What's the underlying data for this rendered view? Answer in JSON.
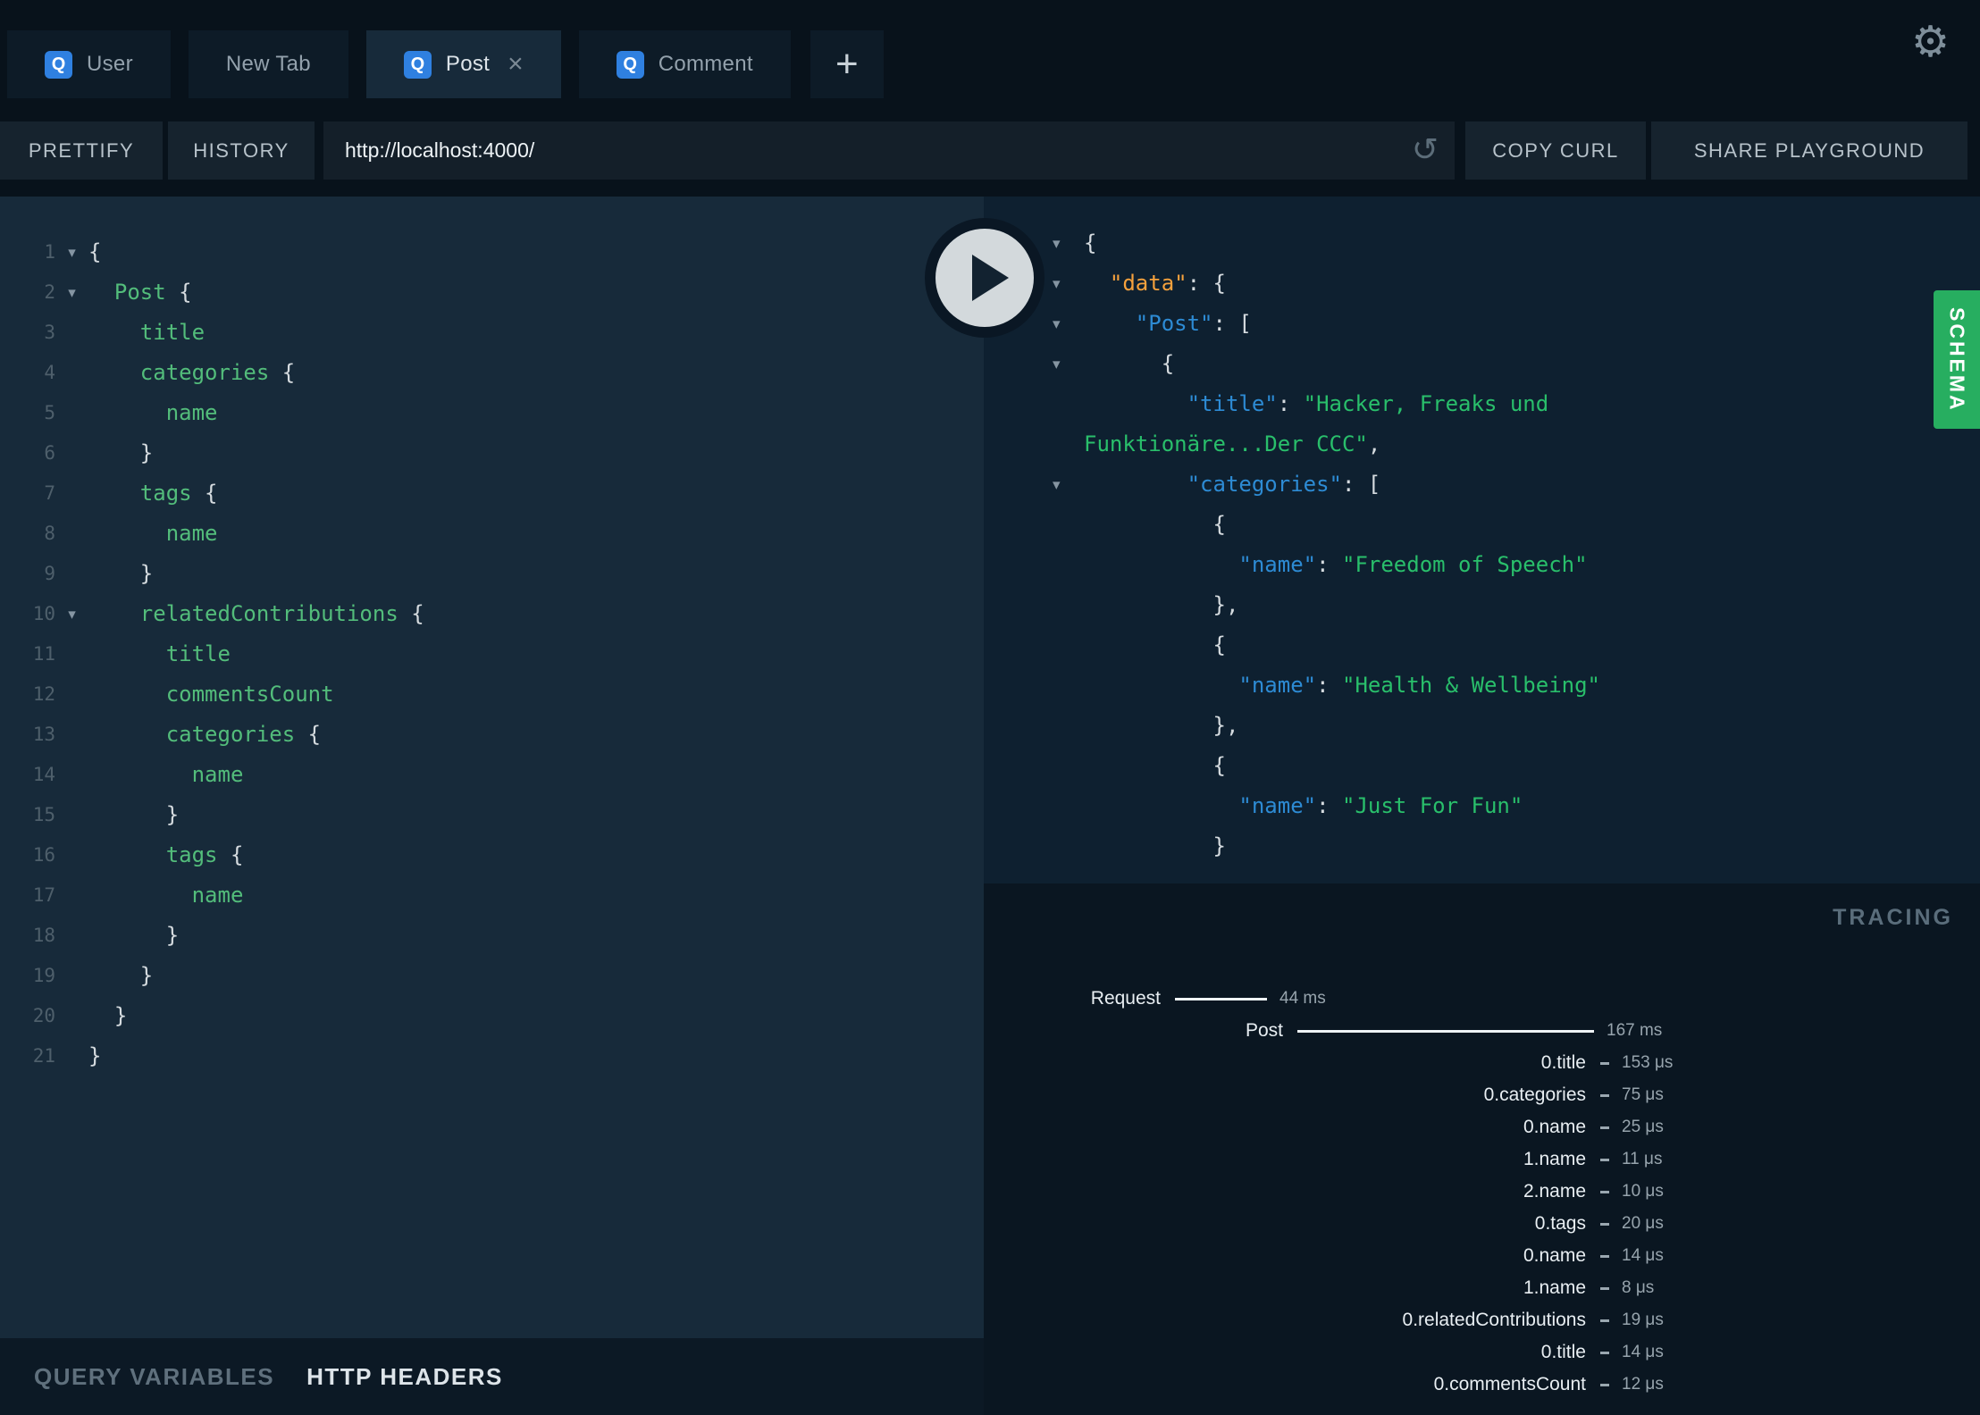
{
  "icons": {
    "settings": "⚙",
    "reload": "↺",
    "fold": "▾",
    "close": "×",
    "plus": "+"
  },
  "colors": {
    "accent_blue": "#2f80e0",
    "schema_green": "#27ae60",
    "field_green": "#53bd7b",
    "key_blue": "#2d8bd4",
    "root_key_orange": "#f5a13d",
    "string_green": "#29bf6b"
  },
  "tabs": {
    "items": [
      {
        "badge": "Q",
        "label": "User",
        "active": false,
        "closable": false
      },
      {
        "badge": null,
        "label": "New Tab",
        "active": false,
        "closable": false
      },
      {
        "badge": "Q",
        "label": "Post",
        "active": true,
        "closable": true
      },
      {
        "badge": "Q",
        "label": "Comment",
        "active": false,
        "closable": false
      }
    ],
    "new_tab_label": "+"
  },
  "toolbar": {
    "prettify_label": "PRETTIFY",
    "history_label": "HISTORY",
    "url_value": "http://localhost:4000/",
    "copy_curl_label": "COPY CURL",
    "share_label": "SHARE PLAYGROUND"
  },
  "schema_tab_label": "SCHEMA",
  "bottom_tabs": {
    "query_variables": "QUERY VARIABLES",
    "http_headers": "HTTP HEADERS"
  },
  "editor": {
    "lines": [
      {
        "num": 1,
        "fold": true,
        "parts": [
          [
            "{",
            "punc"
          ]
        ]
      },
      {
        "num": 2,
        "fold": true,
        "parts": [
          [
            "  ",
            "punc"
          ],
          [
            "Post",
            "field"
          ],
          [
            " {",
            "punc"
          ]
        ]
      },
      {
        "num": 3,
        "fold": false,
        "parts": [
          [
            "    ",
            "punc"
          ],
          [
            "title",
            "field"
          ]
        ]
      },
      {
        "num": 4,
        "fold": false,
        "parts": [
          [
            "    ",
            "punc"
          ],
          [
            "categories",
            "field"
          ],
          [
            " {",
            "punc"
          ]
        ]
      },
      {
        "num": 5,
        "fold": false,
        "parts": [
          [
            "      ",
            "punc"
          ],
          [
            "name",
            "field"
          ]
        ]
      },
      {
        "num": 6,
        "fold": false,
        "parts": [
          [
            "    }",
            "punc"
          ]
        ]
      },
      {
        "num": 7,
        "fold": false,
        "parts": [
          [
            "    ",
            "punc"
          ],
          [
            "tags",
            "field"
          ],
          [
            " {",
            "punc"
          ]
        ]
      },
      {
        "num": 8,
        "fold": false,
        "parts": [
          [
            "      ",
            "punc"
          ],
          [
            "name",
            "field"
          ]
        ]
      },
      {
        "num": 9,
        "fold": false,
        "parts": [
          [
            "    }",
            "punc"
          ]
        ]
      },
      {
        "num": 10,
        "fold": true,
        "parts": [
          [
            "    ",
            "punc"
          ],
          [
            "relatedContributions",
            "field"
          ],
          [
            " {",
            "punc"
          ]
        ]
      },
      {
        "num": 11,
        "fold": false,
        "parts": [
          [
            "      ",
            "punc"
          ],
          [
            "title",
            "field"
          ]
        ]
      },
      {
        "num": 12,
        "fold": false,
        "parts": [
          [
            "      ",
            "punc"
          ],
          [
            "commentsCount",
            "field"
          ]
        ]
      },
      {
        "num": 13,
        "fold": false,
        "parts": [
          [
            "      ",
            "punc"
          ],
          [
            "categories",
            "field"
          ],
          [
            " {",
            "punc"
          ]
        ]
      },
      {
        "num": 14,
        "fold": false,
        "parts": [
          [
            "        ",
            "punc"
          ],
          [
            "name",
            "field"
          ]
        ]
      },
      {
        "num": 15,
        "fold": false,
        "parts": [
          [
            "      }",
            "punc"
          ]
        ]
      },
      {
        "num": 16,
        "fold": false,
        "parts": [
          [
            "      ",
            "punc"
          ],
          [
            "tags",
            "field"
          ],
          [
            " {",
            "punc"
          ]
        ]
      },
      {
        "num": 17,
        "fold": false,
        "parts": [
          [
            "        ",
            "punc"
          ],
          [
            "name",
            "field"
          ]
        ]
      },
      {
        "num": 18,
        "fold": false,
        "parts": [
          [
            "      }",
            "punc"
          ]
        ]
      },
      {
        "num": 19,
        "fold": false,
        "parts": [
          [
            "    }",
            "punc"
          ]
        ]
      },
      {
        "num": 20,
        "fold": false,
        "parts": [
          [
            "  }",
            "punc"
          ]
        ]
      },
      {
        "num": 21,
        "fold": false,
        "parts": [
          [
            "}",
            "punc"
          ]
        ]
      }
    ]
  },
  "result": {
    "lines": [
      {
        "fold": true,
        "parts": [
          [
            "{",
            "punc"
          ]
        ]
      },
      {
        "fold": true,
        "parts": [
          [
            "  ",
            "punc"
          ],
          [
            "\"data\"",
            "keyroot"
          ],
          [
            ": {",
            "punc"
          ]
        ]
      },
      {
        "fold": true,
        "parts": [
          [
            "    ",
            "punc"
          ],
          [
            "\"Post\"",
            "key"
          ],
          [
            ": [",
            "punc"
          ]
        ]
      },
      {
        "fold": true,
        "parts": [
          [
            "      {",
            "punc"
          ]
        ]
      },
      {
        "fold": false,
        "parts": [
          [
            "        ",
            "punc"
          ],
          [
            "\"title\"",
            "key"
          ],
          [
            ": ",
            "punc"
          ],
          [
            "\"Hacker, Freaks und",
            "str"
          ]
        ]
      },
      {
        "fold": false,
        "parts": [
          [
            "Funktionäre...Der CCC\"",
            "str"
          ],
          [
            ",",
            "punc"
          ]
        ]
      },
      {
        "fold": true,
        "parts": [
          [
            "        ",
            "punc"
          ],
          [
            "\"categories\"",
            "key"
          ],
          [
            ": [",
            "punc"
          ]
        ]
      },
      {
        "fold": false,
        "parts": [
          [
            "          {",
            "punc"
          ]
        ]
      },
      {
        "fold": false,
        "parts": [
          [
            "            ",
            "punc"
          ],
          [
            "\"name\"",
            "key"
          ],
          [
            ": ",
            "punc"
          ],
          [
            "\"Freedom of Speech\"",
            "str"
          ]
        ]
      },
      {
        "fold": false,
        "parts": [
          [
            "          },",
            "punc"
          ]
        ]
      },
      {
        "fold": false,
        "parts": [
          [
            "          {",
            "punc"
          ]
        ]
      },
      {
        "fold": false,
        "parts": [
          [
            "            ",
            "punc"
          ],
          [
            "\"name\"",
            "key"
          ],
          [
            ": ",
            "punc"
          ],
          [
            "\"Health & Wellbeing\"",
            "str"
          ]
        ]
      },
      {
        "fold": false,
        "parts": [
          [
            "          },",
            "punc"
          ]
        ]
      },
      {
        "fold": false,
        "parts": [
          [
            "          {",
            "punc"
          ]
        ]
      },
      {
        "fold": false,
        "parts": [
          [
            "            ",
            "punc"
          ],
          [
            "\"name\"",
            "key"
          ],
          [
            ": ",
            "punc"
          ],
          [
            "\"Just For Fun\"",
            "str"
          ]
        ]
      },
      {
        "fold": false,
        "parts": [
          [
            "          }",
            "punc"
          ]
        ]
      }
    ]
  },
  "tracing": {
    "title": "TRACING",
    "rows": [
      {
        "label": "Request",
        "time": "44 ms",
        "level": 0,
        "bar": 0
      },
      {
        "label": "Post",
        "time": "167 ms",
        "level": 1,
        "bar": 1
      },
      {
        "label": "0.title",
        "time": "153 μs",
        "level": 2,
        "bar": null
      },
      {
        "label": "0.categories",
        "time": "75 μs",
        "level": 2,
        "bar": null
      },
      {
        "label": "0.name",
        "time": "25 μs",
        "level": 2,
        "bar": null
      },
      {
        "label": "1.name",
        "time": "11 μs",
        "level": 2,
        "bar": null
      },
      {
        "label": "2.name",
        "time": "10 μs",
        "level": 2,
        "bar": null
      },
      {
        "label": "0.tags",
        "time": "20 μs",
        "level": 2,
        "bar": null
      },
      {
        "label": "0.name",
        "time": "14 μs",
        "level": 2,
        "bar": null
      },
      {
        "label": "1.name",
        "time": "8 μs",
        "level": 2,
        "bar": null
      },
      {
        "label": "0.relatedContributions",
        "time": "19 μs",
        "level": 2,
        "bar": null
      },
      {
        "label": "0.title",
        "time": "14 μs",
        "level": 2,
        "bar": null
      },
      {
        "label": "0.commentsCount",
        "time": "12 μs",
        "level": 2,
        "bar": null
      }
    ]
  }
}
